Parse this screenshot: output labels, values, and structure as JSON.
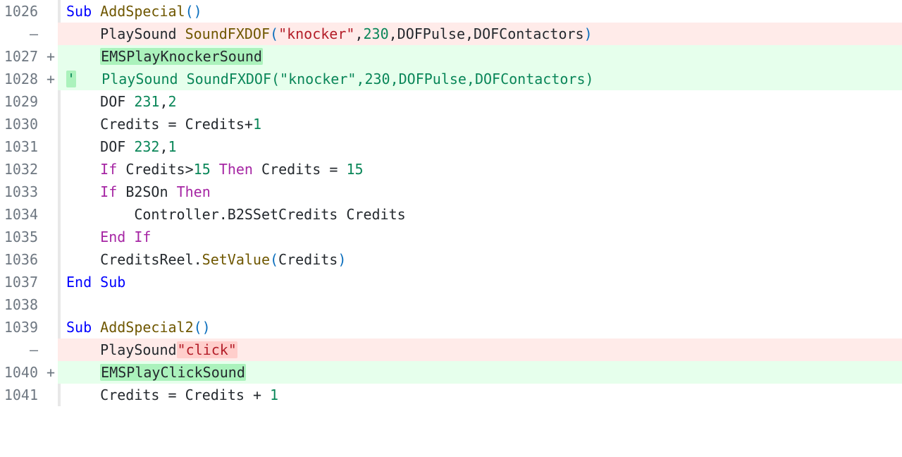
{
  "rows": [
    {
      "num": "1026",
      "marker": "",
      "type": "ctx",
      "tokens": [
        {
          "t": "kw",
          "v": "Sub"
        },
        {
          "t": "sp",
          "v": " "
        },
        {
          "t": "fn",
          "v": "AddSpecial"
        },
        {
          "t": "paren",
          "v": "("
        },
        {
          "t": "paren",
          "v": ")"
        }
      ]
    },
    {
      "num": "—",
      "marker": "",
      "type": "del",
      "tokens": [
        {
          "t": "sp",
          "v": "    "
        },
        {
          "t": "op",
          "v": "PlaySound"
        },
        {
          "t": "sp",
          "v": " "
        },
        {
          "t": "fn",
          "v": "SoundFXDOF"
        },
        {
          "t": "paren",
          "v": "("
        },
        {
          "t": "str",
          "v": "\"knocker\""
        },
        {
          "t": "op",
          "v": ","
        },
        {
          "t": "num",
          "v": "230"
        },
        {
          "t": "op",
          "v": ","
        },
        {
          "t": "op",
          "v": "DOFPulse"
        },
        {
          "t": "op",
          "v": ","
        },
        {
          "t": "op",
          "v": "DOFContactors"
        },
        {
          "t": "paren",
          "v": ")"
        }
      ]
    },
    {
      "num": "1027",
      "marker": "+",
      "type": "add",
      "tokens": [
        {
          "t": "sp",
          "v": "    "
        },
        {
          "t": "op",
          "v": "EMSPlayKnockerSound",
          "hl": "add"
        }
      ]
    },
    {
      "num": "1028",
      "marker": "+",
      "type": "add",
      "tokens": [
        {
          "t": "cmt",
          "v": "'",
          "hl": "add"
        },
        {
          "t": "sp",
          "v": "   "
        },
        {
          "t": "cmt",
          "v": "PlaySound SoundFXDOF(\"knocker\",230,DOFPulse,DOFContactors)"
        }
      ]
    },
    {
      "num": "1029",
      "marker": "",
      "type": "ctx",
      "tokens": [
        {
          "t": "sp",
          "v": "    "
        },
        {
          "t": "op",
          "v": "DOF"
        },
        {
          "t": "sp",
          "v": " "
        },
        {
          "t": "num",
          "v": "231"
        },
        {
          "t": "op",
          "v": ","
        },
        {
          "t": "num",
          "v": "2"
        }
      ]
    },
    {
      "num": "1030",
      "marker": "",
      "type": "ctx",
      "tokens": [
        {
          "t": "sp",
          "v": "    "
        },
        {
          "t": "op",
          "v": "Credits"
        },
        {
          "t": "sp",
          "v": " "
        },
        {
          "t": "op",
          "v": "="
        },
        {
          "t": "sp",
          "v": " "
        },
        {
          "t": "op",
          "v": "Credits"
        },
        {
          "t": "op",
          "v": "+"
        },
        {
          "t": "num",
          "v": "1"
        }
      ]
    },
    {
      "num": "1031",
      "marker": "",
      "type": "ctx",
      "tokens": [
        {
          "t": "sp",
          "v": "    "
        },
        {
          "t": "op",
          "v": "DOF"
        },
        {
          "t": "sp",
          "v": " "
        },
        {
          "t": "num",
          "v": "232"
        },
        {
          "t": "op",
          "v": ","
        },
        {
          "t": "num",
          "v": "1"
        }
      ]
    },
    {
      "num": "1032",
      "marker": "",
      "type": "ctx",
      "tokens": [
        {
          "t": "sp",
          "v": "    "
        },
        {
          "t": "kw2",
          "v": "If"
        },
        {
          "t": "sp",
          "v": " "
        },
        {
          "t": "op",
          "v": "Credits"
        },
        {
          "t": "op",
          "v": ">"
        },
        {
          "t": "num",
          "v": "15"
        },
        {
          "t": "sp",
          "v": " "
        },
        {
          "t": "kw2",
          "v": "Then"
        },
        {
          "t": "sp",
          "v": " "
        },
        {
          "t": "op",
          "v": "Credits"
        },
        {
          "t": "sp",
          "v": " "
        },
        {
          "t": "op",
          "v": "="
        },
        {
          "t": "sp",
          "v": " "
        },
        {
          "t": "num",
          "v": "15"
        }
      ]
    },
    {
      "num": "1033",
      "marker": "",
      "type": "ctx",
      "tokens": [
        {
          "t": "sp",
          "v": "    "
        },
        {
          "t": "kw2",
          "v": "If"
        },
        {
          "t": "sp",
          "v": " "
        },
        {
          "t": "op",
          "v": "B2SOn"
        },
        {
          "t": "sp",
          "v": " "
        },
        {
          "t": "kw2",
          "v": "Then"
        }
      ]
    },
    {
      "num": "1034",
      "marker": "",
      "type": "ctx",
      "tokens": [
        {
          "t": "sp",
          "v": "        "
        },
        {
          "t": "op",
          "v": "Controller"
        },
        {
          "t": "op",
          "v": "."
        },
        {
          "t": "op",
          "v": "B2SSetCredits"
        },
        {
          "t": "sp",
          "v": " "
        },
        {
          "t": "op",
          "v": "Credits"
        }
      ]
    },
    {
      "num": "1035",
      "marker": "",
      "type": "ctx",
      "tokens": [
        {
          "t": "sp",
          "v": "    "
        },
        {
          "t": "kw2",
          "v": "End"
        },
        {
          "t": "sp",
          "v": " "
        },
        {
          "t": "kw2",
          "v": "If"
        }
      ]
    },
    {
      "num": "1036",
      "marker": "",
      "type": "ctx",
      "tokens": [
        {
          "t": "sp",
          "v": "    "
        },
        {
          "t": "op",
          "v": "CreditsReel"
        },
        {
          "t": "op",
          "v": "."
        },
        {
          "t": "fn",
          "v": "SetValue"
        },
        {
          "t": "paren",
          "v": "("
        },
        {
          "t": "op",
          "v": "Credits"
        },
        {
          "t": "paren",
          "v": ")"
        }
      ]
    },
    {
      "num": "1037",
      "marker": "",
      "type": "ctx",
      "tokens": [
        {
          "t": "kw",
          "v": "End"
        },
        {
          "t": "sp",
          "v": " "
        },
        {
          "t": "kw",
          "v": "Sub"
        }
      ]
    },
    {
      "num": "1038",
      "marker": "",
      "type": "ctx",
      "tokens": []
    },
    {
      "num": "1039",
      "marker": "",
      "type": "ctx",
      "tokens": [
        {
          "t": "kw",
          "v": "Sub"
        },
        {
          "t": "sp",
          "v": " "
        },
        {
          "t": "fn",
          "v": "AddSpecial2"
        },
        {
          "t": "paren",
          "v": "("
        },
        {
          "t": "paren",
          "v": ")"
        }
      ]
    },
    {
      "num": "—",
      "marker": "",
      "type": "del",
      "tokens": [
        {
          "t": "sp",
          "v": "    "
        },
        {
          "t": "op",
          "v": "PlaySound"
        },
        {
          "t": "str",
          "v": "\"click\"",
          "hl": "del"
        }
      ]
    },
    {
      "num": "1040",
      "marker": "+",
      "type": "add",
      "tokens": [
        {
          "t": "sp",
          "v": "    "
        },
        {
          "t": "op",
          "v": "EMSPlayClickSound",
          "hl": "add"
        }
      ]
    },
    {
      "num": "1041",
      "marker": "",
      "type": "ctx",
      "tokens": [
        {
          "t": "sp",
          "v": "    "
        },
        {
          "t": "op",
          "v": "Credits"
        },
        {
          "t": "sp",
          "v": " "
        },
        {
          "t": "op",
          "v": "="
        },
        {
          "t": "sp",
          "v": " "
        },
        {
          "t": "op",
          "v": "Credits"
        },
        {
          "t": "sp",
          "v": " "
        },
        {
          "t": "op",
          "v": "+"
        },
        {
          "t": "sp",
          "v": " "
        },
        {
          "t": "num",
          "v": "1"
        }
      ]
    }
  ]
}
